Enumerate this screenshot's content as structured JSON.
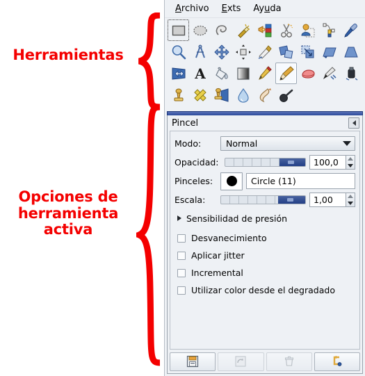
{
  "annotations": {
    "tools_label": "Herramientas",
    "options_label_line1": "Opciones de",
    "options_label_line2": "herramienta",
    "options_label_line3": "activa",
    "color": "#f40000"
  },
  "menubar": {
    "items": [
      {
        "name": "menu-archivo",
        "pre": "",
        "mnemonic": "A",
        "post": "rchivo"
      },
      {
        "name": "menu-exts",
        "pre": "",
        "mnemonic": "E",
        "post": "xts"
      },
      {
        "name": "menu-ayuda",
        "pre": "Ay",
        "mnemonic": "u",
        "post": "da"
      }
    ]
  },
  "toolbox": {
    "rows": [
      [
        {
          "name": "tool-rect-select",
          "title": "Seleccion rectangular",
          "selected": true
        },
        {
          "name": "tool-ellipse-select",
          "title": "Seleccion eliptica",
          "selected": false
        },
        {
          "name": "tool-free-select",
          "title": "Seleccion libre",
          "selected": false
        },
        {
          "name": "tool-fuzzy-select",
          "title": "Seleccion difusa",
          "selected": false
        },
        {
          "name": "tool-select-by-color",
          "title": "Seleccion por color",
          "selected": false
        },
        {
          "name": "tool-scissors-select",
          "title": "Tijeras de seleccion",
          "selected": false
        },
        {
          "name": "tool-foreground-select",
          "title": "Seleccion de frente",
          "selected": false
        },
        {
          "name": "tool-paths",
          "title": "Rutas",
          "selected": false
        },
        {
          "name": "tool-color-picker",
          "title": "Recoge-color",
          "selected": false
        }
      ],
      [
        {
          "name": "tool-zoom",
          "title": "Ampliacion",
          "selected": false
        },
        {
          "name": "tool-measure",
          "title": "Medidor",
          "selected": false
        },
        {
          "name": "tool-move",
          "title": "Mover",
          "selected": false
        },
        {
          "name": "tool-align",
          "title": "Alinear",
          "selected": false
        },
        {
          "name": "tool-crop",
          "title": "Recortar",
          "selected": false
        },
        {
          "name": "tool-rotate",
          "title": "Rotar",
          "selected": false
        },
        {
          "name": "tool-scale",
          "title": "Escalar",
          "selected": false
        },
        {
          "name": "tool-shear",
          "title": "Inclinar",
          "selected": false
        },
        {
          "name": "tool-perspective",
          "title": "Perspectiva",
          "selected": false
        }
      ],
      [
        {
          "name": "tool-flip",
          "title": "Voltear",
          "selected": false
        },
        {
          "name": "tool-text",
          "title": "Texto",
          "selected": false
        },
        {
          "name": "tool-bucket-fill",
          "title": "Relleno de cubeta",
          "selected": false
        },
        {
          "name": "tool-gradient",
          "title": "Mezcla",
          "selected": false
        },
        {
          "name": "tool-pencil",
          "title": "Lapiz",
          "selected": false
        },
        {
          "name": "tool-paintbrush",
          "title": "Pincel",
          "selected": true
        },
        {
          "name": "tool-eraser",
          "title": "Goma de borrar",
          "selected": false
        },
        {
          "name": "tool-airbrush",
          "title": "Aerografo",
          "selected": false
        },
        {
          "name": "tool-ink",
          "title": "Tinta",
          "selected": false
        }
      ],
      [
        {
          "name": "tool-clone",
          "title": "Clonar",
          "selected": false
        },
        {
          "name": "tool-heal",
          "title": "Sanear",
          "selected": false
        },
        {
          "name": "tool-perspective-clone",
          "title": "Clonar con perspectiva",
          "selected": false
        },
        {
          "name": "tool-blur-sharpen",
          "title": "Desenfocar o enfocar",
          "selected": false
        },
        {
          "name": "tool-smudge",
          "title": "Emborronar",
          "selected": false
        },
        {
          "name": "tool-dodge-burn",
          "title": "Blanquear o ennegrecer",
          "selected": false
        }
      ]
    ]
  },
  "dock": {
    "title": "Pincel",
    "menu_button": "dock-menu-arrow"
  },
  "options": {
    "mode": {
      "label": "Modo:",
      "value": "Normal"
    },
    "opacity": {
      "label": "Opacidad:",
      "value": "100,0",
      "slider_percent": 100
    },
    "brushes": {
      "label": "Pinceles:",
      "value": "Circle (11)",
      "preview": "circle-brush"
    },
    "scale": {
      "label": "Escala:",
      "value": "1,00",
      "slider_percent": 100
    },
    "pressure_sensitivity": {
      "label": "Sensibilidad de presión",
      "expanded": false
    },
    "checkboxes": [
      {
        "name": "checkbox-desvanecimiento",
        "label": "Desvanecimiento",
        "checked": false
      },
      {
        "name": "checkbox-aplicar-jitter",
        "label": "Aplicar jitter",
        "checked": false
      },
      {
        "name": "checkbox-incremental",
        "label": "Incremental",
        "checked": false
      },
      {
        "name": "checkbox-color-degradado",
        "label": "Utilizar color desde el degradado",
        "checked": false
      }
    ]
  },
  "buttonbar": {
    "buttons": [
      {
        "name": "save-options-button",
        "icon": "floppy-disk-icon",
        "disabled": false
      },
      {
        "name": "restore-options-button",
        "icon": "restore-icon",
        "disabled": true
      },
      {
        "name": "delete-options-button",
        "icon": "trash-icon",
        "disabled": true
      },
      {
        "name": "reset-options-button",
        "icon": "reset-arrow-icon",
        "disabled": false
      }
    ]
  }
}
